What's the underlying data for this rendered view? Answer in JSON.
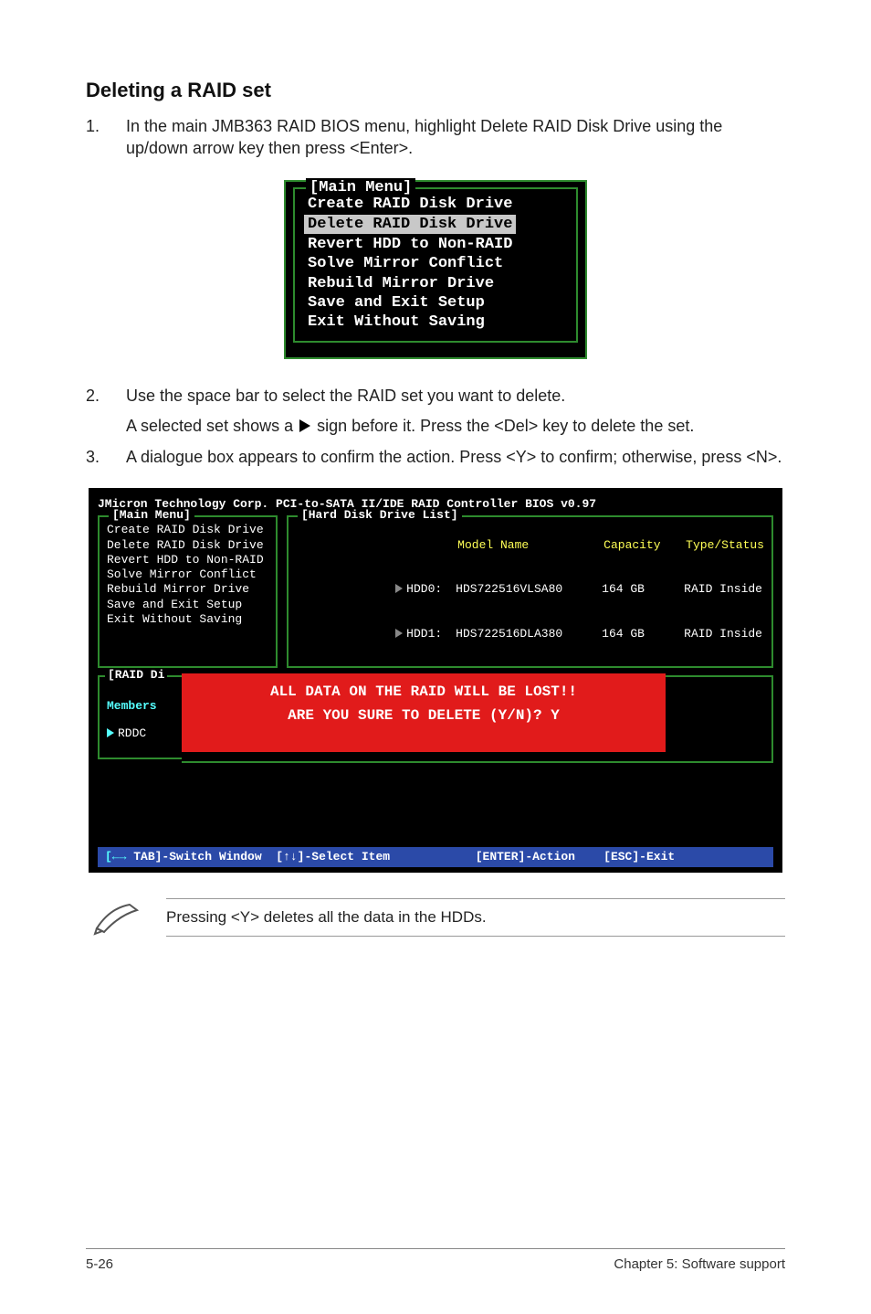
{
  "section_title": "Deleting a RAID set",
  "steps": {
    "s1": {
      "num": "1.",
      "text": "In the main JMB363 RAID BIOS menu, highlight Delete RAID Disk Drive using the up/down arrow key then press <Enter>."
    },
    "s2": {
      "num": "2.",
      "text": "Use the space bar to select the RAID set you want to delete.",
      "sub_a": "A selected set shows a ",
      "sub_b": " sign before it. Press the <Del> key to delete the set."
    },
    "s3": {
      "num": "3.",
      "text": "A dialogue box appears to confirm the action. Press <Y> to confirm; otherwise, press <N>."
    }
  },
  "bios1": {
    "title": "[Main Menu]",
    "items": {
      "i0": "Create RAID Disk Drive",
      "i1": "Delete RAID Disk Drive",
      "i2": "Revert HDD to Non-RAID",
      "i3": "Solve Mirror Conflict",
      "i4": "Rebuild Mirror Drive",
      "i5": "Save and Exit Setup",
      "i6": "Exit Without Saving"
    }
  },
  "bios2": {
    "header": "JMicron Technology Corp. PCI-to-SATA II/IDE RAID Controller BIOS v0.97",
    "main_title": "[Main Menu]",
    "hd_title": "[Hard Disk Drive List]",
    "main_items": {
      "i0": "Create RAID Disk Drive",
      "i1": "Delete RAID Disk Drive",
      "i2": "Revert HDD to Non-RAID",
      "i3": "Solve Mirror Conflict",
      "i4": "Rebuild Mirror Drive",
      "i5": "Save and Exit Setup",
      "i6": "Exit Without Saving"
    },
    "hd_header": {
      "model": "Model Name",
      "capacity": "Capacity",
      "type": "Type/Status"
    },
    "hd_rows": {
      "r0": {
        "slot": "HDD0:",
        "model": "HDS722516VLSA80",
        "cap": "164 GB",
        "type": "RAID Inside"
      },
      "r1": {
        "slot": "HDD1:",
        "model": "HDS722516DLA380",
        "cap": "164 GB",
        "type": "RAID Inside"
      }
    },
    "raid_title": "[RAID Di",
    "members_label": "Members",
    "rddc_label": "RDDC",
    "warn_line1": "ALL DATA ON THE RAID WILL BE LOST!!",
    "warn_line2": "ARE YOU SURE TO DELETE (Y/N)? Y",
    "footer": {
      "tab": "TAB]-Switch Window",
      "arrows": "[↑↓]-Select Item",
      "enter": "[ENTER]-Action",
      "esc": "[ESC]-Exit",
      "lead": "[←→ "
    }
  },
  "note_text": "Pressing <Y> deletes all the data in the HDDs.",
  "page_footer": {
    "left": "5-26",
    "right": "Chapter 5: Software support"
  }
}
